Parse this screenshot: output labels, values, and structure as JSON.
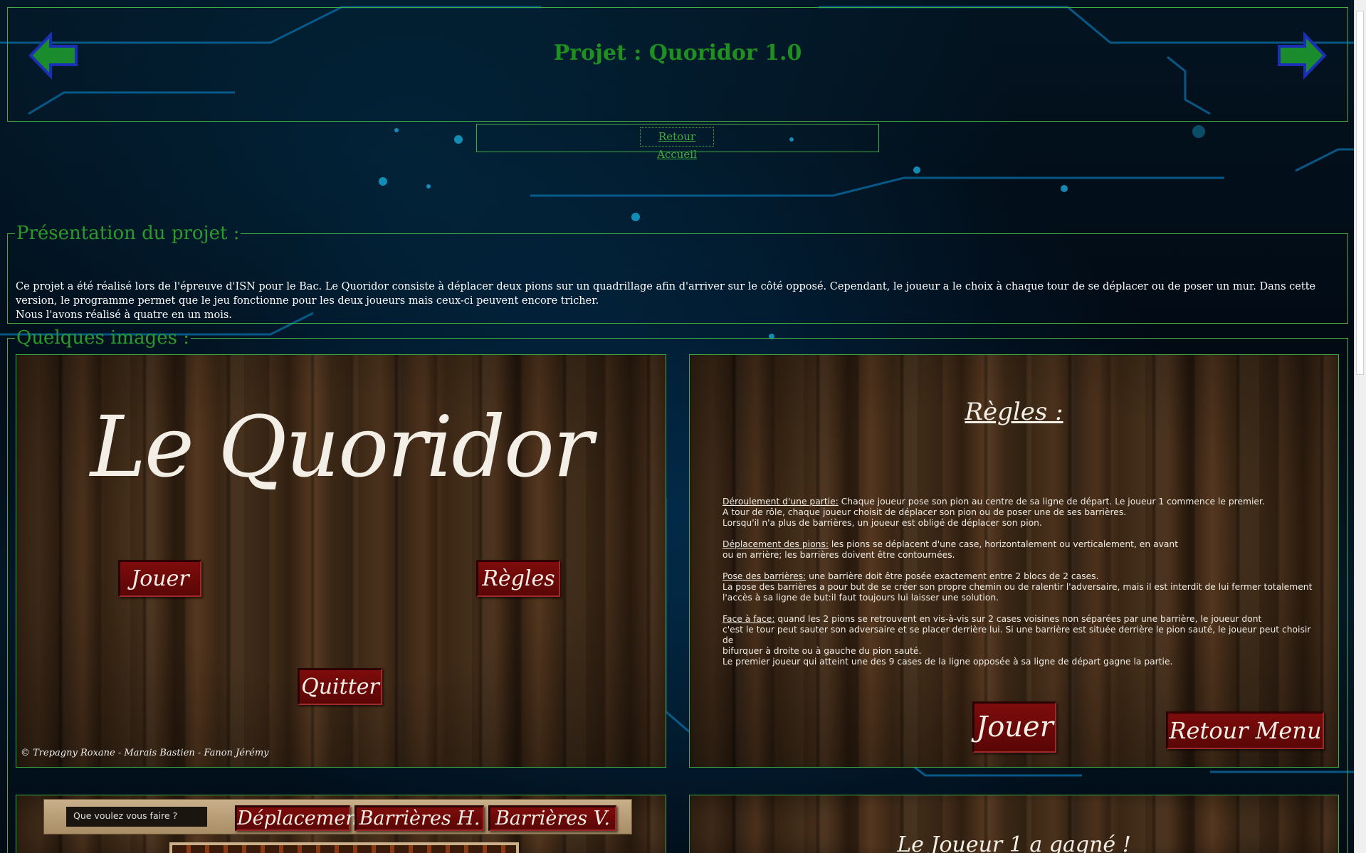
{
  "header": {
    "title": "Projet : Quoridor 1.0"
  },
  "nav": {
    "home_link": "Retour Accueil"
  },
  "presentation": {
    "legend": "Présentation du projet :",
    "line1": "Ce projet a été réalisé lors de l'épreuve d'ISN pour le Bac. Le Quoridor consiste à déplacer deux pions sur un quadrillage afin d'arriver sur le côté opposé. Cependant, le joueur a le choix à chaque tour de se déplacer ou de poser un mur. Dans cette version, le programme permet que le jeu fonctionne pour les deux joueurs mais ceux-ci peuvent encore tricher.",
    "line2": "Nous l'avons réalisé à quatre en un mois."
  },
  "images": {
    "legend": "Quelques images :"
  },
  "screenshot_menu": {
    "title": "Le Quoridor",
    "play": "Jouer",
    "rules": "Règles",
    "quit": "Quitter",
    "credits": "© Trepagny Roxane - Marais Bastien - Fanon Jérémy"
  },
  "screenshot_rules": {
    "title": "Règles :",
    "p1_head": "Déroulement d'une partie:",
    "p1_l1": " Chaque joueur pose son pion au centre de sa ligne de départ. Le joueur 1 commence le premier.",
    "p1_l2": "A tour de rôle, chaque joueur choisit de déplacer son pion ou de poser une de ses barrières.",
    "p1_l3": "Lorsqu'il n'a plus de barrières, un joueur est obligé de déplacer son pion.",
    "p2_head": "Déplacement des pions:",
    "p2_l1": " les pions se déplacent d'une case, horizontalement ou verticalement, en avant",
    "p2_l2": "ou en arrière; les barrières doivent être contournées.",
    "p3_head": "Pose des barrières:",
    "p3_l1": " une barrière doit être posée exactement entre 2 blocs de 2 cases.",
    "p3_l2": "La pose des barrières a pour but de se créer son propre chemin ou de ralentir l'adversaire, mais il est interdit de lui fermer totalement",
    "p3_l3": "l'accès à sa ligne de but:il faut toujours lui laisser une solution.",
    "p4_head": "Face à face:",
    "p4_l1": " quand les 2 pions se retrouvent en vis-à-vis sur 2 cases voisines non séparées par une barrière, le joueur dont",
    "p4_l2": " c'est le tour peut sauter son adversaire et se placer derrière lui. Si une barrière est située derrière le pion sauté, le joueur peut choisir de",
    "p4_l3": "bifurquer à droite ou à gauche du pion sauté.",
    "p4_l4": "Le premier joueur qui atteint une des 9 cases de la ligne opposée à sa ligne de départ gagne la partie.",
    "play": "Jouer",
    "back_menu": "Retour Menu"
  },
  "screenshot_game": {
    "question": "Que voulez vous faire ?",
    "moves": "Déplacements",
    "barriers_h": "Barrières H.",
    "barriers_v": "Barrières V."
  },
  "screenshot_win": {
    "title": "Le Joueur 1 a gagné !"
  },
  "colors": {
    "accent_green": "#1f8f1f",
    "border_green": "#3fae3f",
    "button_red": "#6e0909"
  }
}
